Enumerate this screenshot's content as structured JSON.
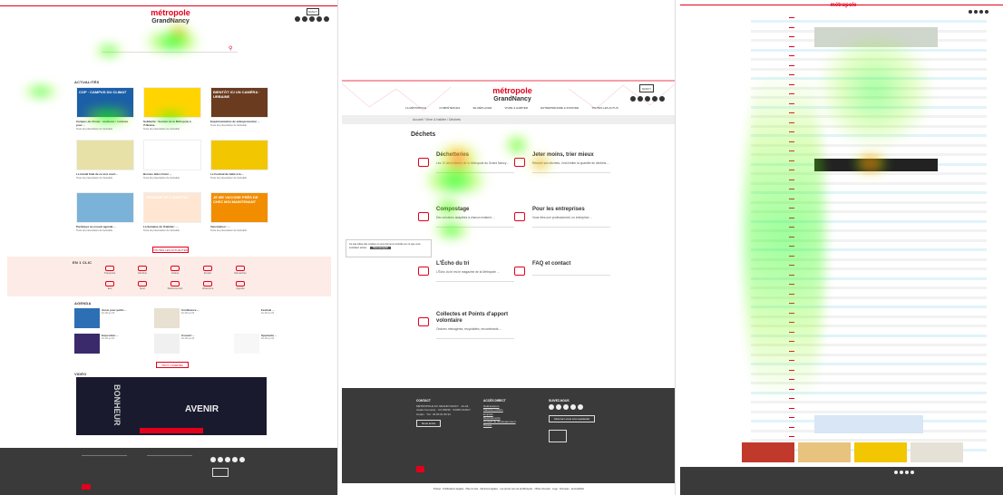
{
  "brand": {
    "line1": "métropole",
    "line2": "GrandNancy",
    "badge": "NANCY"
  },
  "colors": {
    "accent": "#e2001a",
    "footer": "#3a3a3a",
    "quick_bg": "#fcebe6"
  },
  "home": {
    "actualites_title": "ACTUALITÉS",
    "news": [
      {
        "img_label": "COP · CAMPUS DU CLIMAT",
        "title": "Campus du Climat : étudiants ! nominés pour ...",
        "text": "Texte de présentation de l'actualité.",
        "img_bg": "#1b5fa8"
      },
      {
        "img_label": "",
        "title": "Solidarité : Soutien de la Métropole à l'Ukraine",
        "text": "Texte de présentation de l'actualité.",
        "img_bg": "#ffd400"
      },
      {
        "img_label": "BIENTÔT ICI UN CAMÉRA · URBAINE",
        "title": "Expérimentation de vidéoprotection ...",
        "text": "Texte de présentation de l'actualité.",
        "img_bg": "#6a3b1f"
      },
      {
        "img_label": "",
        "title": "Le travail final de ce mot court...",
        "text": "Texte de présentation de l'actualité.",
        "img_bg": "#e7e1a7"
      },
      {
        "img_label": "EN TRANSITION",
        "title": "Bonnes Idées Futur ...",
        "text": "Texte de présentation de l'actualité.",
        "img_bg": "#ffffff"
      },
      {
        "img_label": "",
        "title": "Le Festival du bébé à la ...",
        "text": "Texte de présentation de l'actualité.",
        "img_bg": "#f2c600"
      },
      {
        "img_label": "",
        "title": "Participez au nouvel agenda ...",
        "text": "Texte de présentation de l'actualité.",
        "img_bg": "#7bb3d8"
      },
      {
        "img_label": "SEMAINE DE L'HABITAT",
        "title": "La Semaine de l'Habitat : ...",
        "text": "Texte de présentation de l'actualité.",
        "img_bg": "#ffe6d2"
      },
      {
        "img_label": "JE ME VACCINE PRÈS DE CHEZ MOI MAINTENANT",
        "title": "Vaccination : ...",
        "text": "Texte de présentation de l'actualité.",
        "img_bg": "#f28d00"
      }
    ],
    "more_news": "TOUTES LES ACTUALITÉS",
    "quick_title": "EN 1 CLIC",
    "quick": [
      "Transports",
      "Déchets",
      "Culture",
      "Emploi",
      "Démarches",
      "Eau",
      "Sport",
      "Stationnement",
      "Urbanisme",
      "Agenda"
    ],
    "agenda_title": "AGENDA",
    "events": [
      {
        "title": "Aussi pour petits ...",
        "date": "Du 00 au 00"
      },
      {
        "title": "Conférence ...",
        "date": "Du 00 au 00"
      },
      {
        "title": "Festival ...",
        "date": "Du 00 au 00"
      },
      {
        "title": "Exposition ...",
        "date": "Du 00 au 00"
      },
      {
        "title": "Concert ...",
        "date": "Du 00 au 00"
      },
      {
        "title": "Spectacle ...",
        "date": "Du 00 au 00"
      }
    ],
    "more_events": "TOUT L'AGENDA",
    "video_title": "VIDÉO",
    "video_text": "AVENIR",
    "video_left": "BONHEUR"
  },
  "dechets": {
    "nav": [
      "LA MÉTROPOLE",
      "COMPÉTENCES",
      "SE DÉPLACER",
      "VIVRE & HABITER",
      "ENTREPRENDRE & INNOVER",
      "TOUTES LES ACTUS"
    ],
    "breadcrumb": "Accueil / Vivre & habiter / Déchets",
    "title": "Déchets",
    "tiles": [
      {
        "title": "Déchetteries",
        "text": "Les 10 déchetteries de la Métropole du Grand Nancy ..."
      },
      {
        "title": "Jeter moins, trier mieux",
        "text": "Réduire ses déchets, c'est limiter la quantité de déchets ..."
      },
      {
        "title": "Compostage",
        "text": "Des solutions adaptées à chacun existent ..."
      },
      {
        "title": "Pour les entreprises",
        "text": "Vous êtes une professionnel, un entreprise ..."
      },
      {
        "title": "L'Écho du tri",
        "text": "L'Écho du tri est le magazine de la Métropole ..."
      },
      {
        "title": "FAQ et contact",
        "text": ""
      },
      {
        "title": "Collectes et Points d'apport volontaire",
        "text": "Ordures ménagères, recyclables, encombrants ..."
      }
    ],
    "cookie": {
      "text": "Ce site utilise des cookies et vous donne le contrôle sur ce que vous souhaitez activer",
      "button": "Tout accepter"
    },
    "footer": {
      "contact_h": "CONTACT",
      "contact": "MÉTROPOLE DU GRAND NANCY · 22-24, viaduc Kennedy · CO 80036 · 54035 NANCY Cedex · Tél : 03 83 91 83 91",
      "contact_btn": "Nous écrire",
      "access_h": "ACCÈS DIRECT",
      "access": [
        "Délibérations",
        "Marchés publics",
        "Emplois",
        "Recrutements",
        "Conseil de développement",
        "Presse"
      ],
      "follow_h": "SUIVEZ-NOUS",
      "follow_btn": "Abonnez-vous à la newsletter",
      "bottom": "Presse · Publications légales · Plan du site · Mentions légales · Les pivots vers de la Métropole · Offres d'emploi · Logo · Données · Accessibilité"
    }
  }
}
